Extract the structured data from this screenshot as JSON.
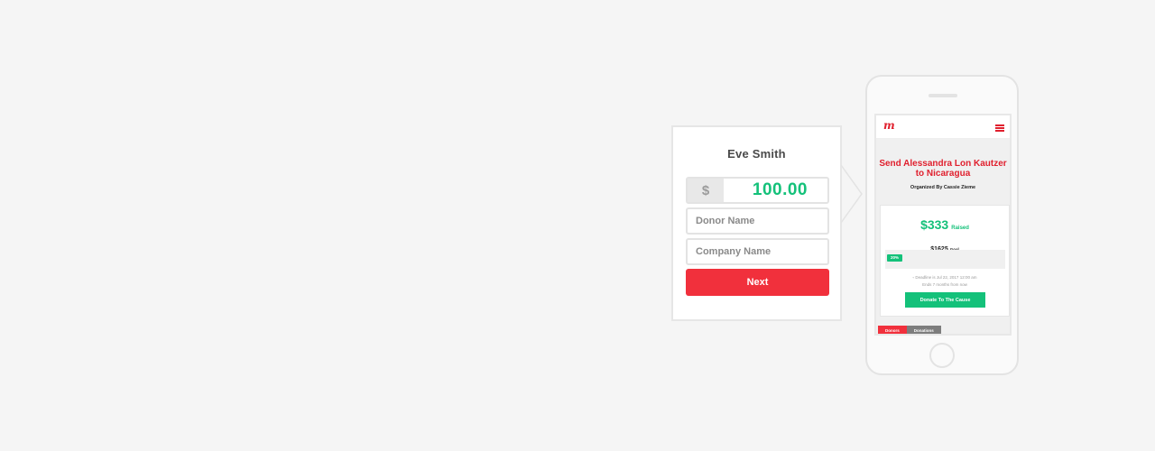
{
  "form": {
    "name": "Eve Smith",
    "currency_symbol": "$",
    "amount": "100.00",
    "donor_name_placeholder": "Donor Name",
    "company_name_placeholder": "Company Name",
    "next_label": "Next"
  },
  "phone": {
    "logo": "m",
    "campaign_title": "Send Alessandra Lon Kautzer to Nicaragua",
    "organizer": "Organized By Cassie Zieme",
    "raised_amount": "$333",
    "raised_label": "Raised",
    "goal_amount": "$1625",
    "goal_label": "Goal",
    "progress_label": "20%",
    "progress_fraction": 0.2,
    "deadline": "Deadline is Jul 22, 2017 12:00 am",
    "ends": "Ends 7 months from now",
    "donate_label": "Donate To The Cause",
    "tabs": [
      "Donors",
      "Donations"
    ]
  },
  "colors": {
    "accent_red": "#f1303c",
    "accent_green": "#14c17a",
    "background": "#f5f5f5"
  }
}
